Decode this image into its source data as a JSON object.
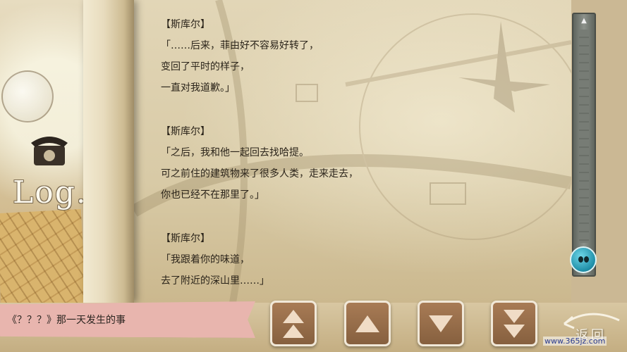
{
  "sidebar": {
    "log_title": "Log."
  },
  "log": {
    "entries": [
      {
        "speaker": "【斯库尔】",
        "lines": [
          "「……后来，菲由好不容易好转了，",
          "变回了平时的样子，",
          "一直对我道歉。」"
        ]
      },
      {
        "speaker": "【斯库尔】",
        "lines": [
          "「之后，我和他一起回去找哈提。",
          "可之前住的建筑物来了很多人类，走来走去，",
          "你也已经不在那里了。」"
        ]
      },
      {
        "speaker": "【斯库尔】",
        "lines": [
          "「我跟着你的味道，",
          "去了附近的深山里……」"
        ]
      }
    ]
  },
  "scrollbar": {
    "up_arrow": "▲"
  },
  "footer": {
    "chapter_title": "《？？？》那一天发生的事",
    "back_label": "返回",
    "watermark": "www.365jz.com"
  },
  "colors": {
    "chapter_tag": "#e8b5ae",
    "nav_button": "#9b6f4b",
    "scroll_thumb": "#2aa6bf"
  }
}
